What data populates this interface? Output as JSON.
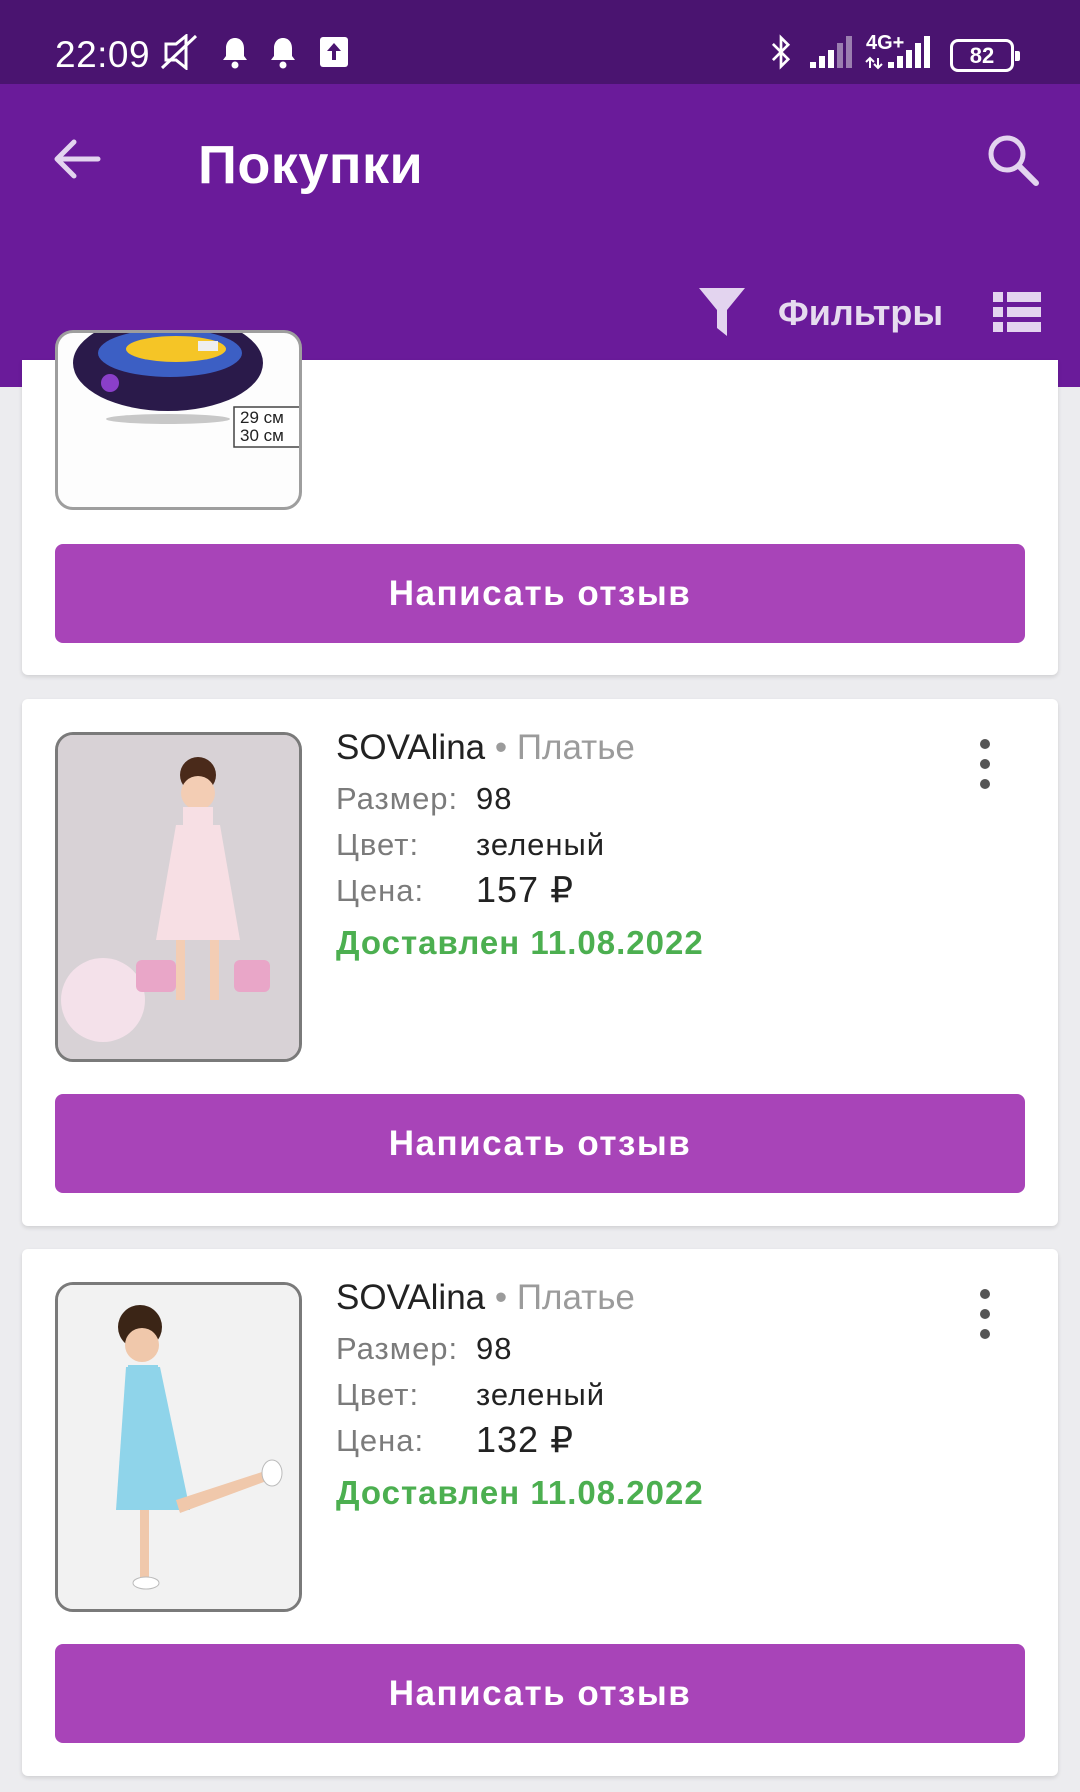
{
  "status_bar": {
    "time": "22:09",
    "icons": [
      "mute-icon",
      "bell-icon",
      "bell-icon",
      "upload-icon",
      "bluetooth-icon",
      "signal-icon",
      "4g-signal-icon"
    ],
    "network_label": "4G+",
    "battery": "82"
  },
  "app_bar": {
    "title": "Покупки",
    "filter_label": "Фильтры",
    "background_color": "#6a1b9a"
  },
  "top_card": {
    "image_caption_lines": [
      "29 см",
      "30 см"
    ],
    "review_button": "Написать отзыв"
  },
  "items": [
    {
      "brand": "SOVAlina",
      "separator": "•",
      "category": "Платье",
      "size_label": "Размер:",
      "size": "98",
      "color_label": "Цвет:",
      "color": "зеленый",
      "price_label": "Цена:",
      "price": "157 ₽",
      "status": "Доставлен 11.08.2022",
      "review_button": "Написать отзыв"
    },
    {
      "brand": "SOVAlina",
      "separator": "•",
      "category": "Платье",
      "size_label": "Размер:",
      "size": "98",
      "color_label": "Цвет:",
      "color": "зеленый",
      "price_label": "Цена:",
      "price": "132 ₽",
      "status": "Доставлен 11.08.2022",
      "review_button": "Написать отзыв"
    }
  ],
  "colors": {
    "status_bar": "#4a1470",
    "accent_button": "#a844b8",
    "delivered_status": "#4caf50"
  }
}
